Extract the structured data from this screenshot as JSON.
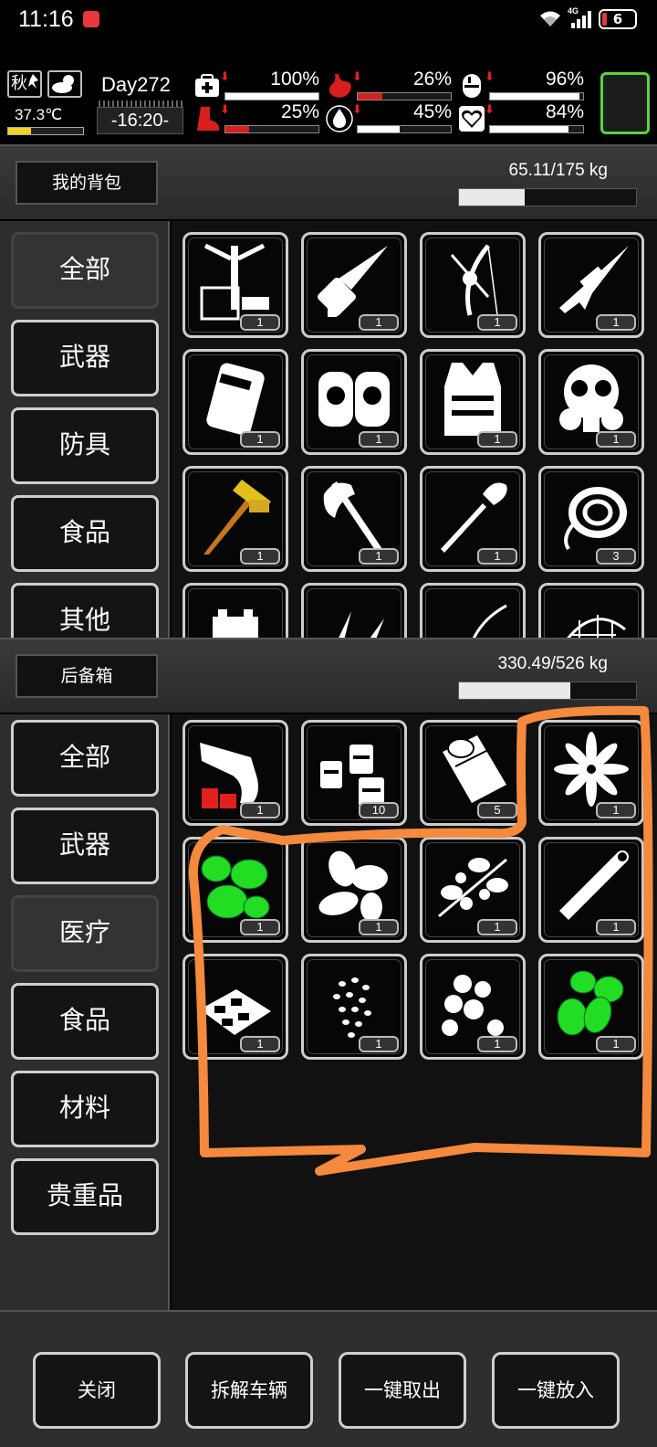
{
  "statusbar": {
    "time": "11:16",
    "network": "4G",
    "battery": "6"
  },
  "hud": {
    "season": "秋",
    "temperature": "37.3℃",
    "day": "Day272",
    "clock": "-16:20-",
    "stats": [
      {
        "name": "health",
        "value": "100%",
        "fill": 1.0,
        "color": "#ffffff"
      },
      {
        "name": "hunger",
        "value": "26%",
        "fill": 0.26,
        "color": "#d81f1f"
      },
      {
        "name": "energy",
        "value": "96%",
        "fill": 0.96,
        "color": "#ffffff"
      },
      {
        "name": "stamina",
        "value": "25%",
        "fill": 0.25,
        "color": "#d81f1f"
      },
      {
        "name": "thirst",
        "value": "45%",
        "fill": 0.45,
        "color": "#ffffff"
      },
      {
        "name": "mood",
        "value": "84%",
        "fill": 0.84,
        "color": "#ffffff"
      }
    ]
  },
  "backpack": {
    "title": "我的背包",
    "weight": "65.11/175 kg",
    "weight_fill": 0.372,
    "categories": [
      "全部",
      "武器",
      "防具",
      "食品",
      "其他"
    ],
    "items": [
      {
        "icon": "bipod-icon",
        "count": "1"
      },
      {
        "icon": "minigun-icon",
        "count": "1"
      },
      {
        "icon": "compound-bow-icon",
        "count": "1"
      },
      {
        "icon": "sniper-rifle-icon",
        "count": "1"
      },
      {
        "icon": "backpack-armor-icon",
        "count": "1"
      },
      {
        "icon": "knee-pads-icon",
        "count": "1"
      },
      {
        "icon": "body-armor-icon",
        "count": "1"
      },
      {
        "icon": "gas-mask-icon",
        "count": "1"
      },
      {
        "icon": "golden-hammer-icon",
        "count": "1"
      },
      {
        "icon": "axe-icon",
        "count": "1"
      },
      {
        "icon": "shovel-icon",
        "count": "1"
      },
      {
        "icon": "rope-icon",
        "count": "3"
      },
      {
        "icon": "battery-icon",
        "count": ""
      },
      {
        "icon": "bullets-icon",
        "count": ""
      },
      {
        "icon": "wire-icon",
        "count": ""
      },
      {
        "icon": "net-icon",
        "count": ""
      }
    ]
  },
  "trunk": {
    "title": "后备箱",
    "weight": "330.49/526 kg",
    "weight_fill": 0.628,
    "categories": [
      "全部",
      "武器",
      "医疗",
      "食品",
      "材料",
      "贵重品"
    ],
    "items": [
      {
        "icon": "flare-gun-icon",
        "count": "1"
      },
      {
        "icon": "pill-bottles-icon",
        "count": "10"
      },
      {
        "icon": "bandage-roll-icon",
        "count": "5"
      },
      {
        "icon": "star-anise-icon",
        "count": "1"
      },
      {
        "icon": "green-herb-icon",
        "count": "1"
      },
      {
        "icon": "leaves-icon",
        "count": "1"
      },
      {
        "icon": "berry-branch-icon",
        "count": "1"
      },
      {
        "icon": "cinnamon-stick-icon",
        "count": "1"
      },
      {
        "icon": "dried-slices-icon",
        "count": "1"
      },
      {
        "icon": "seeds-icon",
        "count": "1"
      },
      {
        "icon": "nuts-icon",
        "count": "1"
      },
      {
        "icon": "green-herb-pods-icon",
        "count": "1"
      }
    ]
  },
  "actions": [
    "关闭",
    "拆解车辆",
    "一键取出",
    "一键放入"
  ],
  "colors": {
    "accent_green": "#5bd33b",
    "herb_green": "#22dd22",
    "alert_red": "#e21f1f",
    "annotation_orange": "#f5893d"
  }
}
